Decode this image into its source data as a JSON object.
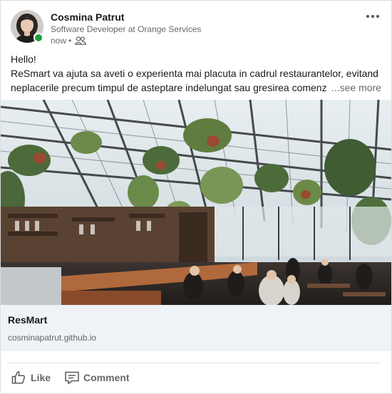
{
  "post": {
    "author": {
      "name": "Cosmina Patrut",
      "headline": "Software Developer at Orange Services",
      "time": "now",
      "separator": "•",
      "visibility_icon": "connections-icon",
      "presence_color": "#1e9e3a"
    },
    "more_icon": "more-options-icon",
    "text": {
      "greeting": "Hello!",
      "line_1": "ReSmart va ajuta sa aveti o experienta mai placuta in cadrul restaurantelor, evitand",
      "line_2": "neplacerile precum timpul de asteptare indelungat sau gresirea comenzi",
      "see_more": "...see more"
    },
    "link_preview": {
      "title": "ResMart",
      "domain": "cosminapatrut.github.io",
      "background": "#eef3f8"
    },
    "actions": {
      "like_label": "Like",
      "like_icon": "thumbs-up-icon",
      "comment_label": "Comment",
      "comment_icon": "speech-bubble-icon"
    }
  }
}
